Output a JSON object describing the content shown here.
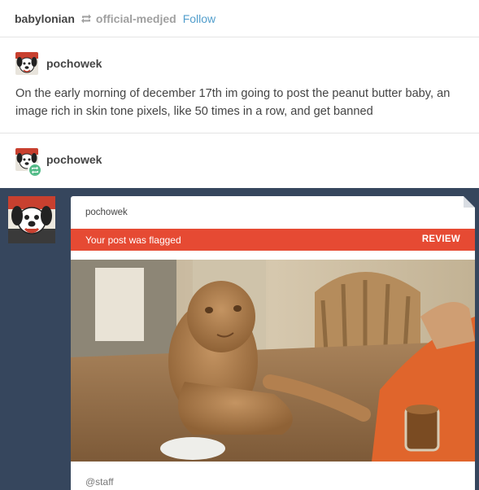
{
  "header": {
    "username": "babylonian",
    "reblogged_from": "official-medjed",
    "follow_label": "Follow"
  },
  "post1": {
    "username": "pochowek",
    "text": "On the early morning of december 17th im going to post the peanut butter baby, an image rich in skin tone pixels, like 50 times in a row, and get banned"
  },
  "post2": {
    "username": "pochowek"
  },
  "screenshot": {
    "card_username": "pochowek",
    "flag_message": "Your post was flagged",
    "review_label": "REVIEW",
    "tag": "@staff"
  },
  "colors": {
    "dashboard_bg": "#36465d",
    "flag_red": "#e64a33",
    "follow_blue": "#529ecc",
    "reblog_green": "#56bc8a"
  },
  "icons": [
    "reblog-icon",
    "dog-avatar"
  ]
}
